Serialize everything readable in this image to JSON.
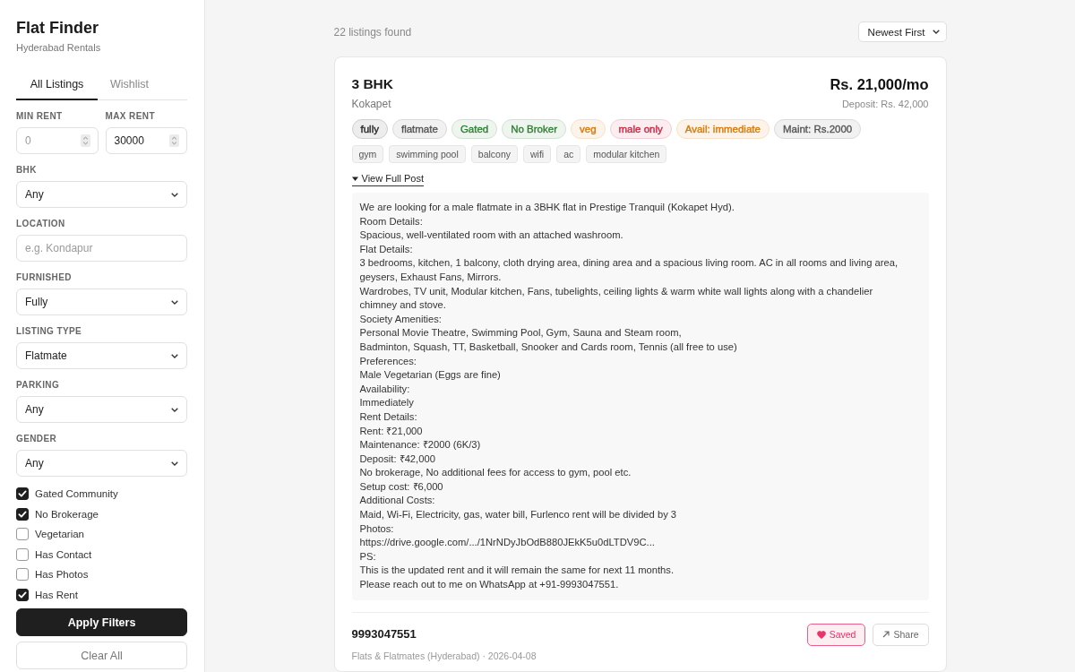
{
  "sidebar": {
    "title": "Flat Finder",
    "subtitle": "Hyderabad Rentals",
    "tabs": [
      {
        "label": "All Listings",
        "selected": true
      },
      {
        "label": "Wishlist",
        "selected": false
      }
    ],
    "rent_fields": [
      {
        "label": "MIN RENT",
        "placeholder": "0"
      },
      {
        "label": "MAX RENT",
        "value": "30000"
      }
    ],
    "filters": [
      {
        "kind": "select",
        "label": "BHK",
        "value": "Any"
      },
      {
        "kind": "text",
        "label": "LOCATION",
        "placeholder": "e.g. Kondapur"
      },
      {
        "kind": "select",
        "label": "FURNISHED",
        "value": "Fully"
      },
      {
        "kind": "select",
        "label": "LISTING TYPE",
        "value": "Flatmate"
      },
      {
        "kind": "select",
        "label": "PARKING",
        "value": "Any"
      },
      {
        "kind": "select",
        "label": "GENDER",
        "value": "Any"
      }
    ],
    "checkboxes": [
      {
        "label": "Gated Community",
        "checked": true
      },
      {
        "label": "No Brokerage",
        "checked": true
      },
      {
        "label": "Vegetarian",
        "checked": false
      },
      {
        "label": "Has Contact",
        "checked": false
      },
      {
        "label": "Has Photos",
        "checked": false
      },
      {
        "label": "Has Rent",
        "checked": true
      }
    ],
    "buttons": [
      {
        "kind": "primary",
        "label": "Apply Filters"
      },
      {
        "kind": "secondary",
        "label": "Clear All"
      }
    ]
  },
  "results": {
    "count": "22 listings found",
    "sort": "Newest First"
  },
  "listing": {
    "title": "3 BHK",
    "location": "Kokapet",
    "price": "Rs. 21,000/mo",
    "deposit": "Deposit: Rs. 42,000",
    "tags": [
      {
        "label": "fully",
        "color": "#222222"
      },
      {
        "label": "flatmate",
        "color": "#555555"
      },
      {
        "label": "Gated",
        "color": "#2e7d32"
      },
      {
        "label": "No Broker",
        "color": "#2e7d32"
      },
      {
        "label": "veg",
        "color": "#d97706"
      },
      {
        "label": "male only",
        "color": "#c8243f"
      },
      {
        "label": "Avail: immediate",
        "color": "#d97706"
      },
      {
        "label": "Maint: Rs.2000",
        "color": "#555555"
      }
    ],
    "amenities": [
      "gym",
      "swimming pool",
      "balcony",
      "wifi",
      "ac",
      "modular kitchen"
    ],
    "post": {
      "toggle": "View Full Post",
      "expanded": true,
      "body": "We are looking for a male flatmate in a 3BHK flat in Prestige Tranquil (Kokapet Hyd).\nRoom Details:\nSpacious, well-ventilated room with an attached washroom.\nFlat Details:\n3 bedrooms, kitchen, 1 balcony, cloth drying area, dining area and a spacious living room. AC in all rooms and living area,\ngeysers, Exhaust Fans, Mirrors.\nWardrobes, TV unit, Modular kitchen, Fans, tubelights, ceiling lights & warm white wall lights along with a chandelier\nchimney and stove.\nSociety Amenities:\nPersonal Movie Theatre, Swimming Pool, Gym, Sauna and Steam room,\nBadminton, Squash, TT, Basketball, Snooker and Cards room, Tennis (all free to use)\nPreferences:\nMale Vegetarian (Eggs are fine)\nAvailability:\nImmediately\nRent Details:\nRent: ₹21,000\nMaintenance: ₹2000 (6K/3)\nDeposit: ₹42,000\nNo brokerage, No additional fees for access to gym, pool etc.\nSetup cost: ₹6,000\nAdditional Costs:\nMaid, Wi-Fi, Electricity, gas, water bill, Furlenco rent will be divided by 3\nPhotos:\nhttps://drive.google.com/.../1NrNDyJbOdB880JEkK5u0dLTDV9C...\nPS:\nThis is the updated rent and it will remain the same for next 11 months.\nPlease reach out to me on WhatsApp at +91-9993047551."
    },
    "contact": "9993047551",
    "meta": "Flats & Flatmates (Hyderabad) · 2026-04-08",
    "save_button": {
      "label": "Saved",
      "saved": true
    },
    "share_button": {
      "label": "Share"
    }
  }
}
